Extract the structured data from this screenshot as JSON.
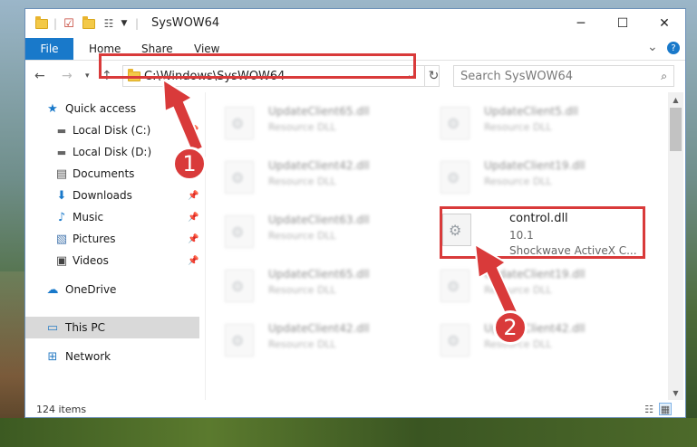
{
  "window": {
    "title": "SysWOW64",
    "minimize": "─",
    "maximize": "☐",
    "close": "✕"
  },
  "ribbon": {
    "tabs": [
      "File",
      "Home",
      "Share",
      "View"
    ],
    "expand": "⌄",
    "help": "?"
  },
  "address": {
    "path": "C:\\Windows\\SysWOW64",
    "search_placeholder": "Search SysWOW64"
  },
  "nav": {
    "items": [
      {
        "label": "Quick access",
        "icon": "star-icon"
      },
      {
        "label": "Local Disk (C:)",
        "icon": "drive-icon",
        "pinned": true
      },
      {
        "label": "Local Disk (D:)",
        "icon": "drive-icon",
        "pinned": true
      },
      {
        "label": "Documents",
        "icon": "documents-icon",
        "pinned": true
      },
      {
        "label": "Downloads",
        "icon": "download-icon",
        "pinned": true
      },
      {
        "label": "Music",
        "icon": "music-icon",
        "pinned": true
      },
      {
        "label": "Pictures",
        "icon": "pictures-icon",
        "pinned": true
      },
      {
        "label": "Videos",
        "icon": "videos-icon",
        "pinned": true
      },
      {
        "label": "OneDrive",
        "icon": "cloud-icon"
      },
      {
        "label": "This PC",
        "icon": "computer-icon",
        "selected": true
      },
      {
        "label": "Network",
        "icon": "network-icon"
      }
    ]
  },
  "files": {
    "blurred": [
      {
        "name": "UpdateClient65.dll",
        "type": "Resource DLL"
      },
      {
        "name": "UpdateClient5.dll",
        "type": "Resource DLL"
      },
      {
        "name": "UpdateClient42.dll",
        "type": "Resource DLL"
      },
      {
        "name": "UpdateClient19.dll",
        "type": "Resource DLL"
      },
      {
        "name": "UpdateClient63.dll",
        "type": "Resource DLL"
      },
      {
        "name": "UpdateClient65.dll",
        "type": "Resource DLL"
      },
      {
        "name": "UpdateClient19.dll",
        "type": "Resource DLL"
      },
      {
        "name": "UpdateClient42.dll",
        "type": "Resource DLL"
      },
      {
        "name": "UpdateClient42.dll",
        "type": "Resource DLL"
      }
    ],
    "selected": {
      "name": "control.dll",
      "version": "10.1",
      "description": "Shockwave ActiveX C..."
    }
  },
  "status": {
    "item_count": "124 items"
  },
  "callouts": [
    "1",
    "2"
  ],
  "colors": {
    "accent": "#1979ca",
    "highlight": "#d93a3a"
  }
}
